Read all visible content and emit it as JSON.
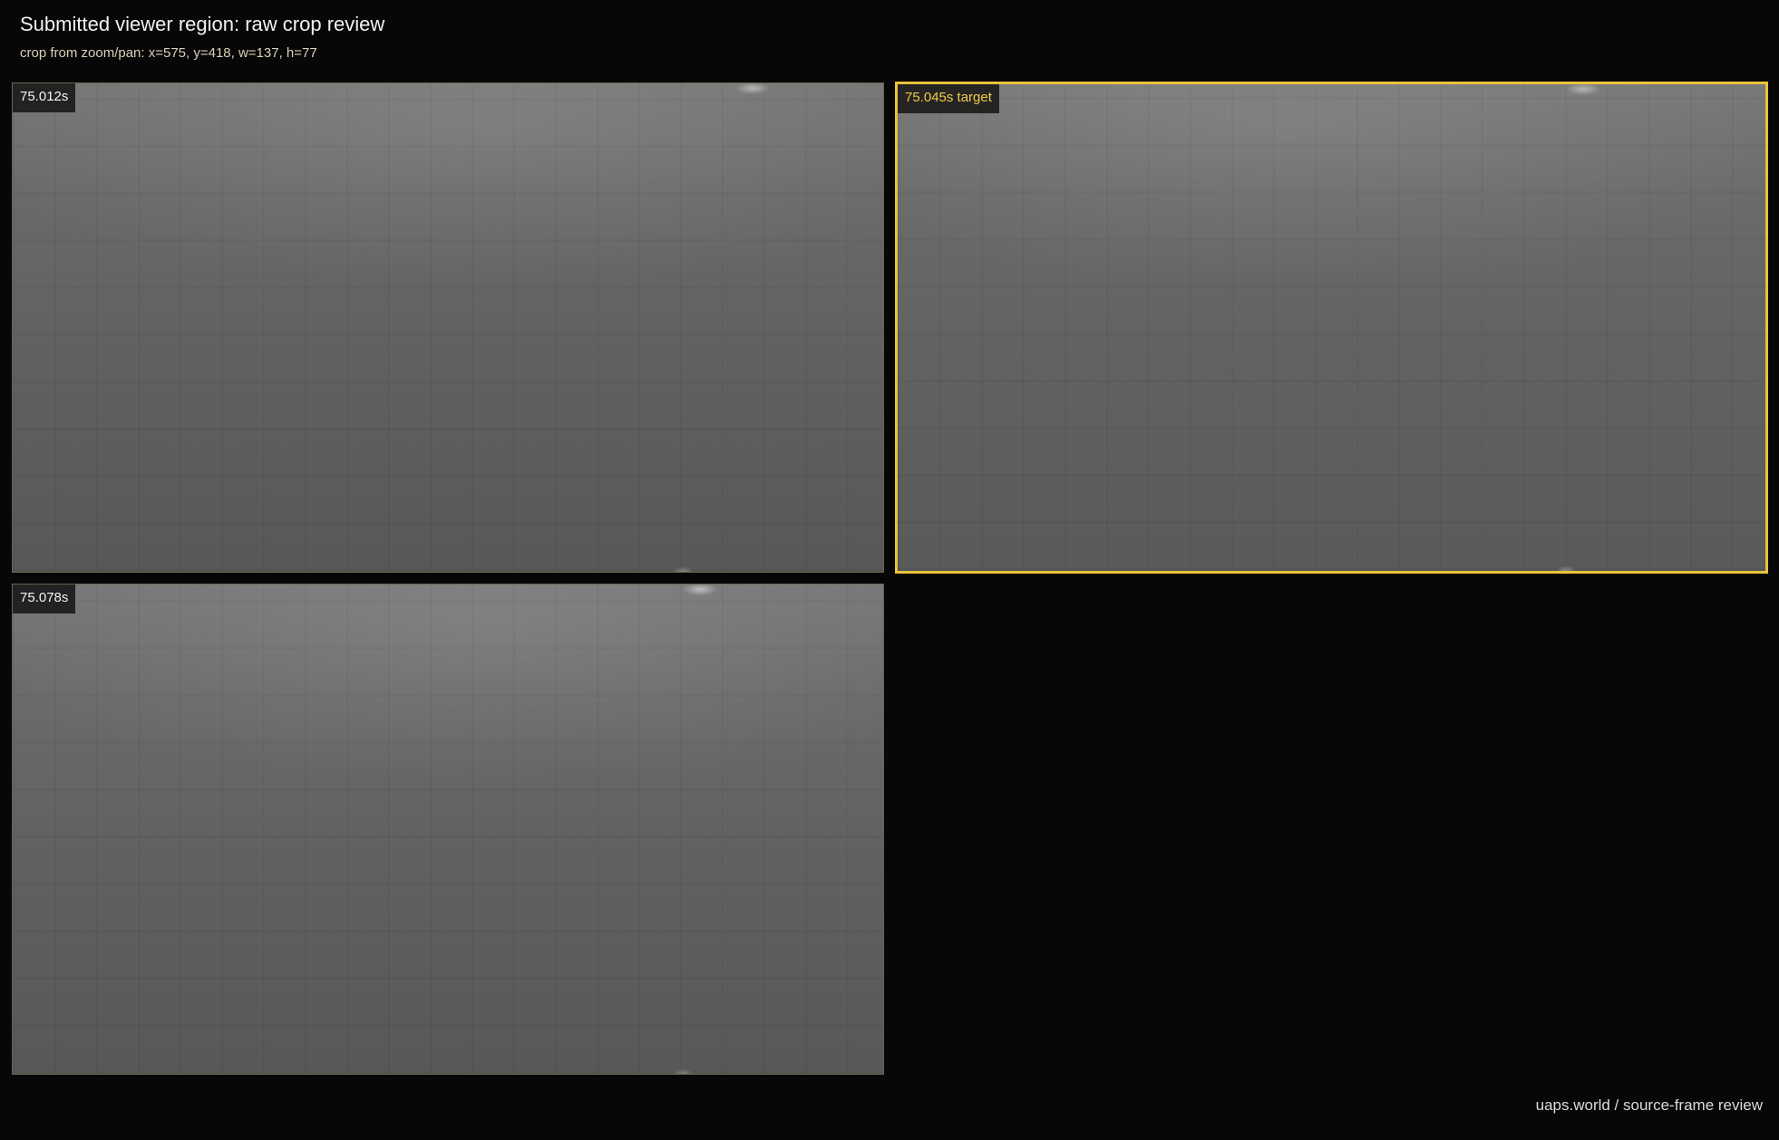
{
  "header": {
    "title": "Submitted viewer region: raw crop review",
    "subtitle": "crop from zoom/pan: x=575, y=418, w=137, h=77"
  },
  "frames": [
    {
      "label": "75.012s",
      "is_target": false
    },
    {
      "label": "75.045s target",
      "is_target": true
    },
    {
      "label": "75.078s",
      "is_target": false
    }
  ],
  "footer": {
    "text": "uaps.world / source-frame review"
  },
  "colors": {
    "background": "#070707",
    "target_accent": "#e8c23a",
    "frame_border": "#68674f"
  }
}
